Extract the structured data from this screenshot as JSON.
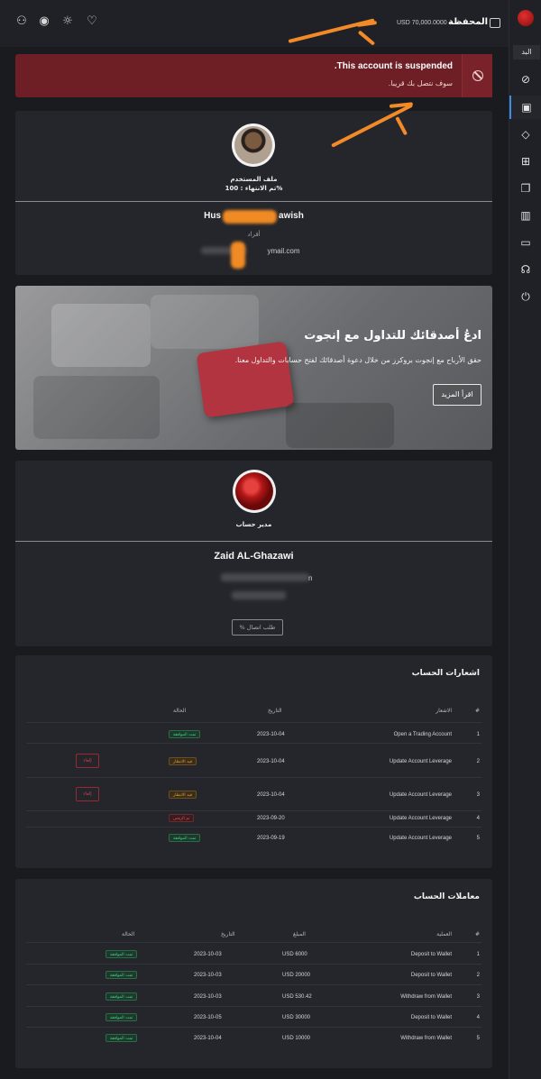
{
  "topbar": {
    "wallet_title": "المحفظة",
    "wallet_amount": "USD 70,000.0000"
  },
  "sidebar": {
    "label": "البد"
  },
  "alert": {
    "title": "This account is suspended.",
    "subtitle": "سوف نتصل بك قريبا."
  },
  "profile": {
    "label": "ملف المستخدم",
    "completion": "تم الانتهاء : 100%",
    "name_start": "Hus",
    "name_end": "awish",
    "type": "أفراد",
    "email_domain": "ymail.com"
  },
  "promo": {
    "title": "ادعُ أصدقائك للتداول مع إنجوت",
    "text": "حقق الأرباح مع إنجوت بروكرز من خلال دعوة أصدقائك لفتح حسابات والتداول معنا.",
    "button": "اقرأ المزيد"
  },
  "manager": {
    "label": "مدير حساب",
    "name": "Zaid AL-Ghazawi",
    "phone_tail": "n",
    "contact_button": "% طلب اتصال"
  },
  "notifications": {
    "title": "اشعارات الحساب",
    "headers": {
      "num": "#",
      "notice": "الاشعار",
      "date": "التاريخ",
      "status": "الحالة"
    },
    "rows": [
      {
        "num": "1",
        "notice": "Open a Trading Account",
        "date": "2023-10-04",
        "status": "تمت الموافقة",
        "status_type": "green",
        "cancel": ""
      },
      {
        "num": "2",
        "notice": "Update Account Leverage",
        "date": "2023-10-04",
        "status": "قيد الانتظار",
        "status_type": "orange",
        "cancel": "إلغاء"
      },
      {
        "num": "3",
        "notice": "Update Account Leverage",
        "date": "2023-10-04",
        "status": "قيد الانتظار",
        "status_type": "orange",
        "cancel": "إلغاء"
      },
      {
        "num": "4",
        "notice": "Update Account Leverage",
        "date": "2023-09-20",
        "status": "تم الرفض",
        "status_type": "red",
        "cancel": ""
      },
      {
        "num": "5",
        "notice": "Update Account Leverage",
        "date": "2023-09-19",
        "status": "تمت الموافقة",
        "status_type": "green",
        "cancel": ""
      }
    ]
  },
  "transactions": {
    "title": "معاملات الحساب",
    "headers": {
      "num": "#",
      "operation": "العملية",
      "amount": "المبلغ",
      "date": "التاريخ",
      "status": "الحالة"
    },
    "rows": [
      {
        "num": "1",
        "operation": "Deposit to Wallet",
        "amount": "USD 6000",
        "date": "2023-10-03",
        "status": "تمت الموافقة"
      },
      {
        "num": "2",
        "operation": "Deposit to Wallet",
        "amount": "USD 20000",
        "date": "2023-10-03",
        "status": "تمت الموافقة"
      },
      {
        "num": "3",
        "operation": "Withdraw from Wallet",
        "amount": "USD 530.42",
        "date": "2023-10-03",
        "status": "تمت الموافقة"
      },
      {
        "num": "4",
        "operation": "Deposit to Wallet",
        "amount": "USD 30000",
        "date": "2023-10-05",
        "status": "تمت الموافقة"
      },
      {
        "num": "5",
        "operation": "Withdraw from Wallet",
        "amount": "USD 10000",
        "date": "2023-10-04",
        "status": "تمت الموافقة"
      }
    ]
  }
}
